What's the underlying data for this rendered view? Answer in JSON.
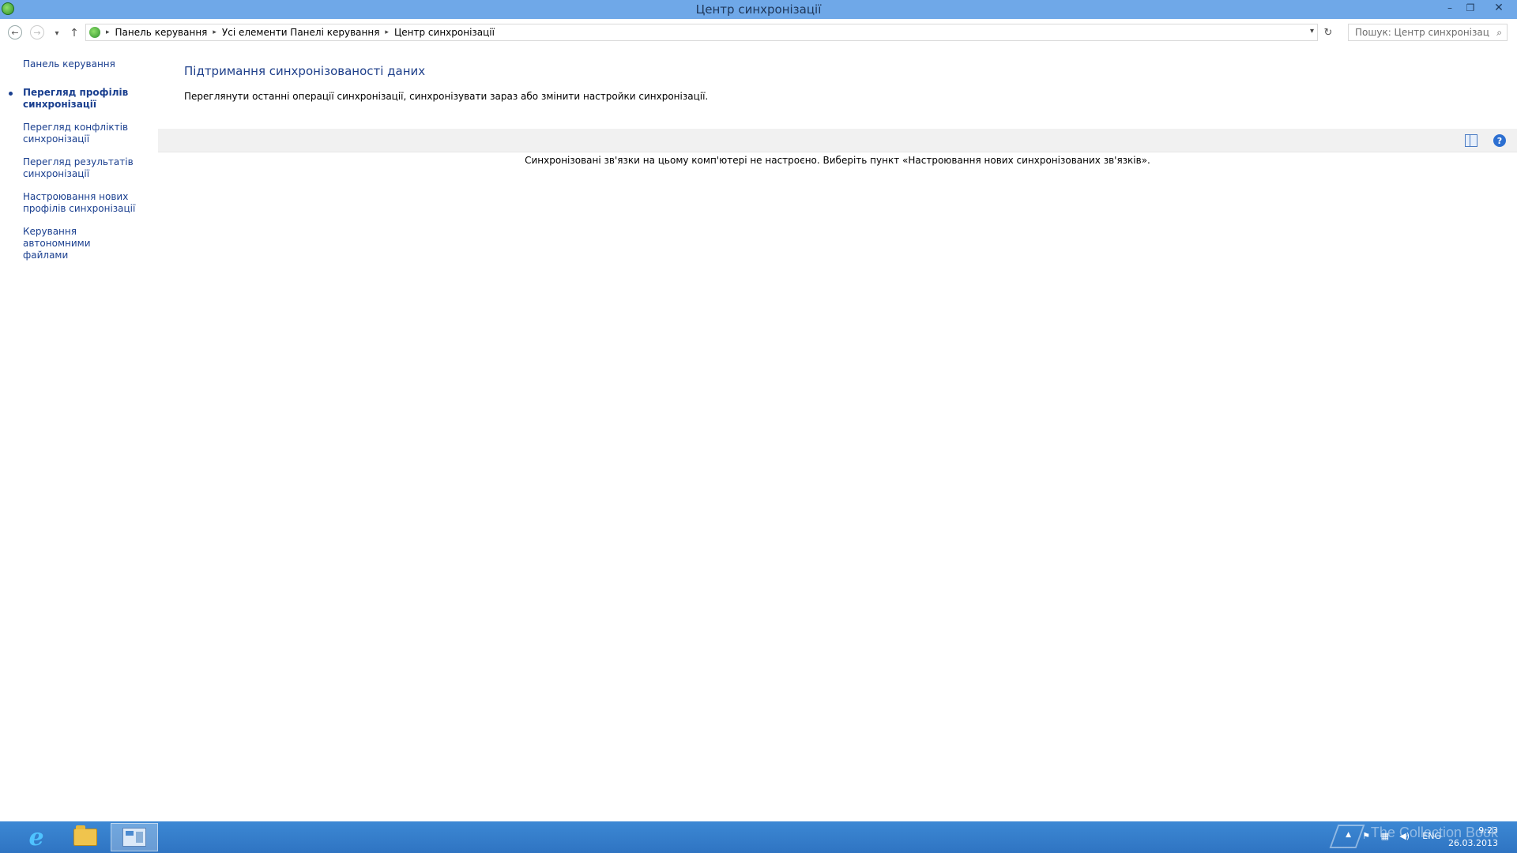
{
  "window": {
    "title": "Центр синхронізації",
    "minimize_glyph": "–",
    "restore_glyph": "❐",
    "close_glyph": "✕"
  },
  "nav": {
    "back_glyph": "←",
    "forward_glyph": "→",
    "history_glyph": "▾",
    "up_glyph": "↑",
    "breadcrumbs": [
      "Панель керування",
      "Усі елементи Панелі керування",
      "Центр синхронізації"
    ],
    "separator_glyph": "▸",
    "refresh_glyph": "↻",
    "search_placeholder": "Пошук: Центр синхронізації",
    "search_icon": "⌕"
  },
  "leftnav": {
    "home": "Панель керування",
    "items": [
      {
        "line1": "Перегляд профілів",
        "line2": "синхронізації",
        "active": true
      },
      {
        "line1": "Перегляд конфліктів",
        "line2": "синхронізації",
        "active": false
      },
      {
        "line1": "Перегляд результатів",
        "line2": "синхронізації",
        "active": false
      },
      {
        "line1": "Настроювання нових",
        "line2": "профілів синхронізації",
        "active": false
      },
      {
        "line1": "Керування автономними",
        "line2": "файлами",
        "active": false
      }
    ]
  },
  "main": {
    "title": "Підтримання синхронізованості даних",
    "description": "Переглянути останні операції синхронізації, синхронізувати зараз або змінити настройки синхронізації.",
    "empty_message": "Синхронізовані зв'язки на цьому комп'ютері не настроєно. Виберіть пункт «Настроювання нових синхронізованих зв'язків».",
    "help_glyph": "?"
  },
  "taskbar": {
    "ie_glyph": "e",
    "lang": "ENG",
    "time": "9:23",
    "date": "26.03.2013",
    "watermark": "The Collection Book",
    "tray_up_glyph": "▲",
    "flag_glyph": "⚑",
    "network_glyph": "▦",
    "volume_glyph": "◀)"
  }
}
